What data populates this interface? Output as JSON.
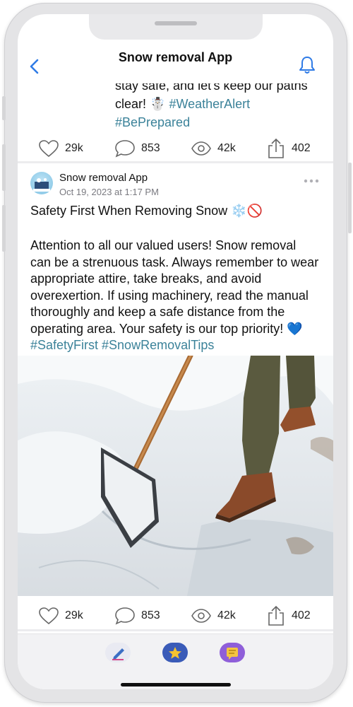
{
  "header": {
    "title": "Snow removal App"
  },
  "prev_post": {
    "lines": [
      "stay safe, and let's keep our paths",
      "clear! ☃️"
    ],
    "hashtags": [
      "#WeatherAlert",
      "#BePrepared"
    ],
    "stats": {
      "likes": "29k",
      "comments": "853",
      "views": "42k",
      "shares": "402"
    }
  },
  "post": {
    "author": "Snow removal App",
    "timestamp": "Oct 19, 2023 at 1:17 PM",
    "title": "Safety First When Removing Snow ❄️🚫",
    "body": "Attention to all our valued users! Snow removal can be a strenuous task. Always remember to wear appropriate attire, take breaks, and avoid overexertion. If using machinery, read the manual thoroughly and keep a safe distance from the operating area. Your safety is our top priority! 💙",
    "hashtags": "#SafetyFirst #SnowRemovalTips",
    "stats": {
      "likes": "29k",
      "comments": "853",
      "views": "42k",
      "shares": "402"
    }
  },
  "colors": {
    "accent": "#2f7be6",
    "hashtag": "#3b8299"
  },
  "tabs": [
    {
      "icon": "compose-icon"
    },
    {
      "icon": "star-icon"
    },
    {
      "icon": "chat-icon"
    }
  ]
}
